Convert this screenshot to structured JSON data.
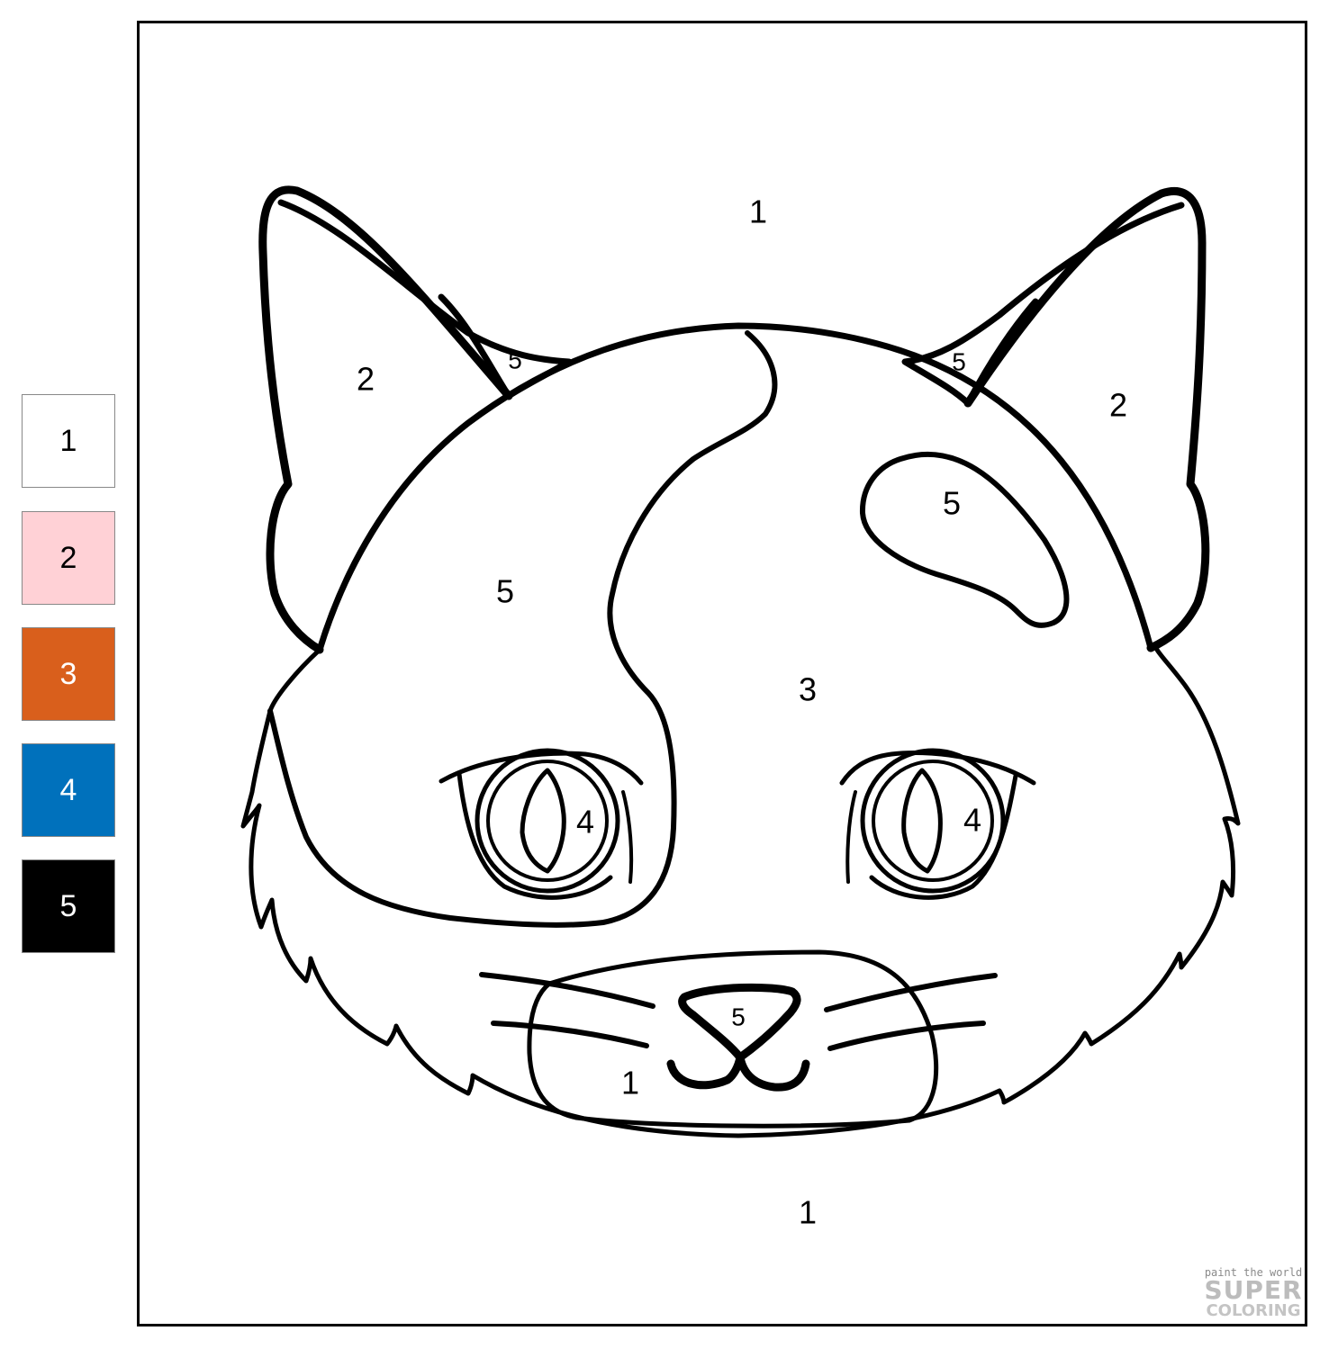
{
  "legend": {
    "items": [
      {
        "number": "1",
        "color": "#ffffff",
        "text_color": "#000000"
      },
      {
        "number": "2",
        "color": "#ffd1d6",
        "text_color": "#000000"
      },
      {
        "number": "3",
        "color": "#d95f1c",
        "text_color": "#ffffff"
      },
      {
        "number": "4",
        "color": "#0071bc",
        "text_color": "#ffffff"
      },
      {
        "number": "5",
        "color": "#000000",
        "text_color": "#ffffff"
      }
    ]
  },
  "picture": {
    "subject": "cat face",
    "labels": {
      "background_top": "1",
      "background_bottom": "1",
      "left_ear_outer": "2",
      "right_ear_outer": "2",
      "left_ear_inner": "5",
      "right_ear_inner": "5",
      "left_patch": "5",
      "right_patch": "5",
      "face": "3",
      "left_eye": "4",
      "right_eye": "4",
      "nose": "5",
      "muzzle": "1"
    }
  },
  "watermark": {
    "tagline": "paint the world",
    "line1": "SUPER",
    "line2": "COLORING"
  }
}
